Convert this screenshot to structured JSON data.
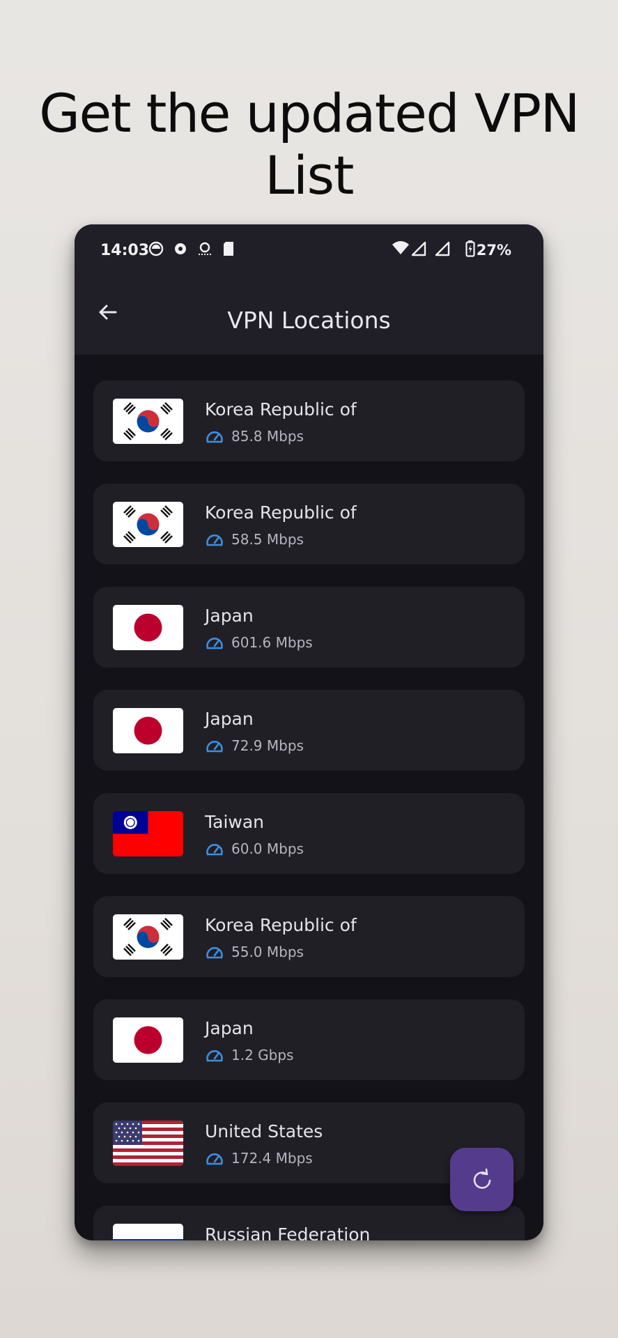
{
  "headline": "Get the updated VPN List",
  "status_bar": {
    "time": "14:03",
    "battery": "27%"
  },
  "app_bar": {
    "title": "VPN Locations"
  },
  "servers": [
    {
      "country": "Korea Republic of",
      "speed": "85.8 Mbps",
      "flag": "kr"
    },
    {
      "country": "Korea Republic of",
      "speed": "58.5 Mbps",
      "flag": "kr"
    },
    {
      "country": "Japan",
      "speed": "601.6 Mbps",
      "flag": "jp"
    },
    {
      "country": "Japan",
      "speed": "72.9 Mbps",
      "flag": "jp"
    },
    {
      "country": "Taiwan",
      "speed": "60.0 Mbps",
      "flag": "tw"
    },
    {
      "country": "Korea Republic of",
      "speed": "55.0 Mbps",
      "flag": "kr"
    },
    {
      "country": "Japan",
      "speed": "1.2 Gbps",
      "flag": "jp"
    },
    {
      "country": "United States",
      "speed": "172.4 Mbps",
      "flag": "us"
    },
    {
      "country": "Russian Federation",
      "speed": "",
      "flag": "ru"
    }
  ],
  "colors": {
    "accent": "#3d8fe0",
    "fab": "#553b8c",
    "card": "#201f26",
    "background": "#131218"
  },
  "icons": {
    "back": "arrow-left-icon",
    "speed": "speedometer-icon",
    "refresh": "refresh-icon"
  }
}
